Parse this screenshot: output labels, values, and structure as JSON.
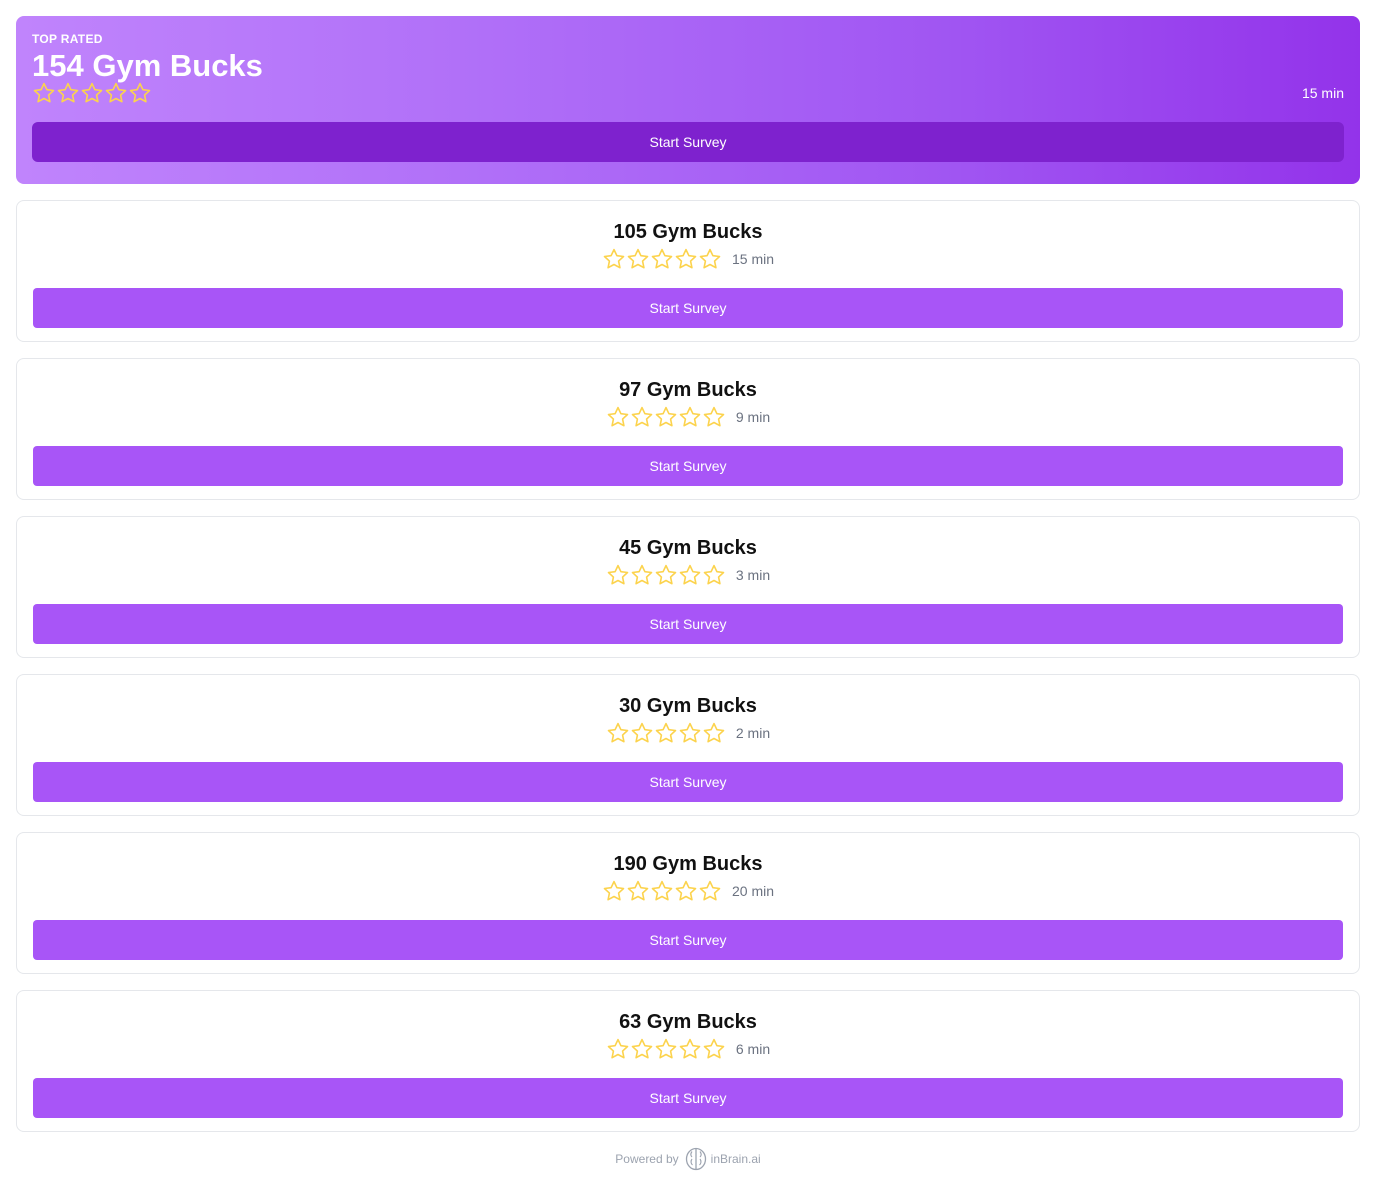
{
  "colors": {
    "star_outline": "#fcd34d",
    "accent": "#a855f7",
    "accent_dark": "#7e22ce",
    "muted_text": "#6b7280"
  },
  "top_card": {
    "label": "TOP RATED",
    "title": "154 Gym Bucks",
    "stars_icon": "star-outline-icon",
    "rating": 0,
    "duration": "15 min",
    "button_label": "Start Survey"
  },
  "surveys": [
    {
      "title": "105 Gym Bucks",
      "rating": 0,
      "duration": "15 min",
      "button_label": "Start Survey"
    },
    {
      "title": "97 Gym Bucks",
      "rating": 0,
      "duration": "9 min",
      "button_label": "Start Survey"
    },
    {
      "title": "45 Gym Bucks",
      "rating": 0,
      "duration": "3 min",
      "button_label": "Start Survey"
    },
    {
      "title": "30 Gym Bucks",
      "rating": 0,
      "duration": "2 min",
      "button_label": "Start Survey"
    },
    {
      "title": "190 Gym Bucks",
      "rating": 0,
      "duration": "20 min",
      "button_label": "Start Survey"
    },
    {
      "title": "63 Gym Bucks",
      "rating": 0,
      "duration": "6 min",
      "button_label": "Start Survey"
    }
  ],
  "footer": {
    "powered_by": "Powered by",
    "brand_icon": "brain-icon",
    "brand": "inBrain.ai"
  }
}
